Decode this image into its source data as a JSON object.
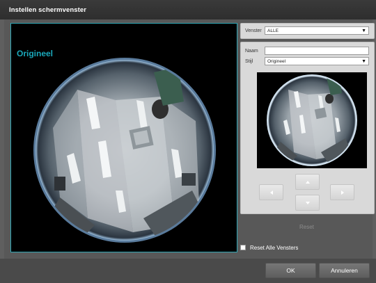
{
  "window": {
    "title": "Instellen schermvenster"
  },
  "main_view": {
    "label": "Origineel"
  },
  "settings": {
    "venster_label": "Venster",
    "venster_value": "ALLE",
    "naam_label": "Naam",
    "naam_value": "",
    "stijl_label": "Stijl",
    "stijl_value": "Origineel"
  },
  "actions": {
    "reset_label": "Reset",
    "reset_all_label": "Reset Alle Vensters",
    "reset_all_checked": false,
    "ok_label": "OK",
    "cancel_label": "Annuleren"
  },
  "icons": {
    "left": "chevron-left-icon",
    "up": "chevron-up-icon",
    "right": "chevron-right-icon",
    "down": "chevron-down-icon",
    "dropdown": "dropdown-arrow-icon"
  }
}
